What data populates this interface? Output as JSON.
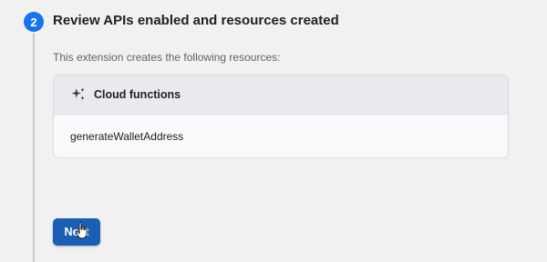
{
  "step": {
    "number": "2",
    "title": "Review APIs enabled and resources created",
    "description": "This extension creates the following resources:"
  },
  "resources": {
    "section_label": "Cloud functions",
    "section_icon": "sparkle-icon",
    "items": [
      {
        "label": "generateWalletAddress"
      }
    ]
  },
  "actions": {
    "next_label": "Next"
  },
  "colors": {
    "accent": "#1a73e8",
    "button": "#1a5fb4",
    "background": "#f1f1f1"
  }
}
